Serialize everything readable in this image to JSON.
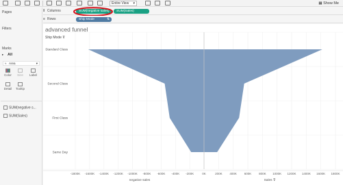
{
  "toolbar": {
    "view_dropdown": "Entire View",
    "show_me": "Show Me"
  },
  "sidebar": {
    "pages": "Pages",
    "filters": "Filters",
    "marks": "Marks",
    "all": "All",
    "mark_type": "Area",
    "buttons": [
      "Color",
      "Size",
      "Label",
      "Detail",
      "Tooltip"
    ],
    "fields": [
      "SUM(negative s...",
      "SUM(Sales)"
    ]
  },
  "shelves": {
    "columns_label": "Columns",
    "rows_label": "Rows",
    "columns_pills": [
      "SUM(negative sales)",
      "SUM(Sales)"
    ],
    "rows_pill": "Ship Mode"
  },
  "colors": {
    "area": "#7f9cbf",
    "pill_green": "#1aa184",
    "pill_blue": "#4f7ba3",
    "highlight": "#d6121b"
  },
  "chart_data": {
    "type": "area",
    "title": "advanced funnel",
    "row_header": "Ship Mode",
    "categories": [
      "Standard Class",
      "Second Class",
      "First Class",
      "Same Day"
    ],
    "series": [
      {
        "name": "SUM(negative sales)",
        "values": [
          -1620000,
          -550000,
          -480000,
          -180000
        ]
      },
      {
        "name": "SUM(Sales)",
        "values": [
          1620000,
          550000,
          480000,
          180000
        ]
      }
    ],
    "left_axis": {
      "label": "negative sales",
      "min": -1800000,
      "max": 0,
      "ticks": [
        "-1800K",
        "-1600K",
        "-1400K",
        "-1200K",
        "-1000K",
        "-800K",
        "-600K",
        "-400K",
        "-200K",
        "0K"
      ]
    },
    "right_axis": {
      "label": "Sales",
      "min": 0,
      "max": 1800000,
      "ticks": [
        "200K",
        "400K",
        "600K",
        "800K",
        "1000K",
        "1200K",
        "1400K",
        "1600K",
        "1800K"
      ]
    },
    "grid": true
  }
}
